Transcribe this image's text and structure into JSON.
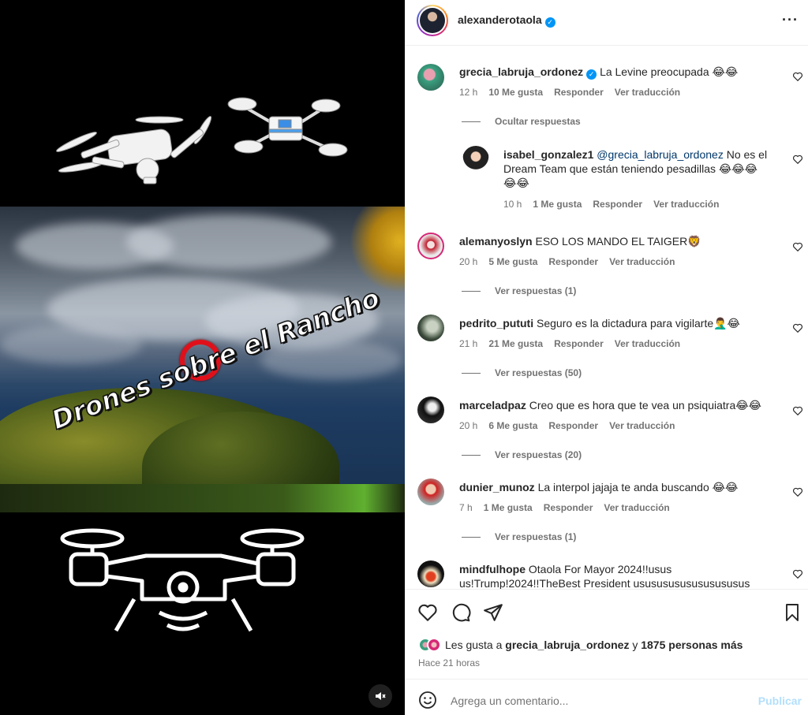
{
  "post": {
    "overlay_text": "Drones sobre el Rancho",
    "author": "alexanderotaola",
    "author_verified": true
  },
  "comments": [
    {
      "user": "grecia_labruja_ordonez",
      "verified": true,
      "text": "La Levine preocupada 😂😂",
      "time": "12 h",
      "likes": "10 Me gusta",
      "reply": "Responder",
      "translate": "Ver traducción",
      "replies_label": "Ocultar respuestas"
    },
    {
      "user": "isabel_gonzalez1",
      "mention": "@grecia_labruja_ordonez",
      "text_line1": "No es el",
      "text_line2": "Dream Team que están teniendo pesadillas 😂😂😂",
      "text_line3": "😂😂",
      "time": "10 h",
      "likes": "1 Me gusta",
      "reply": "Responder",
      "translate": "Ver traducción"
    },
    {
      "user": "alemanyoslyn",
      "text": "ESO LOS MANDO EL TAIGER🦁",
      "time": "20 h",
      "likes": "5 Me gusta",
      "reply": "Responder",
      "translate": "Ver traducción",
      "replies_label": "Ver respuestas (1)"
    },
    {
      "user": "pedrito_pututi",
      "text": "Seguro es la dictadura para vigilarte🤦‍♂️😂",
      "time": "21 h",
      "likes": "21 Me gusta",
      "reply": "Responder",
      "translate": "Ver traducción",
      "replies_label": "Ver respuestas (50)"
    },
    {
      "user": "marceladpaz",
      "text": "Creo que es hora que te vea un psiquiatra😂😂",
      "time": "20 h",
      "likes": "6 Me gusta",
      "reply": "Responder",
      "translate": "Ver traducción",
      "replies_label": "Ver respuestas (20)"
    },
    {
      "user": "dunier_munoz",
      "text": "La interpol jajaja te anda buscando 😂😂",
      "time": "7 h",
      "likes": "1 Me gusta",
      "reply": "Responder",
      "translate": "Ver traducción",
      "replies_label": "Ver respuestas (1)"
    },
    {
      "user": "mindfulhope",
      "text_line1": "Otaola For Mayor 2024!!usus",
      "text_line2": "us!Trump!2024!!TheBest President usususususususususus"
    }
  ],
  "actions": {
    "likes_prefix": "Les gusta a",
    "likes_user": "grecia_labruja_ordonez",
    "likes_and": "y",
    "likes_count": "1875 personas más",
    "posted": "Hace 21 horas"
  },
  "composer": {
    "placeholder": "Agrega un comentario...",
    "publish": "Publicar"
  },
  "colors": {
    "accent": "#0095f6",
    "publish_disabled": "#b2dffc",
    "highlight_ring": "#e0101a"
  }
}
